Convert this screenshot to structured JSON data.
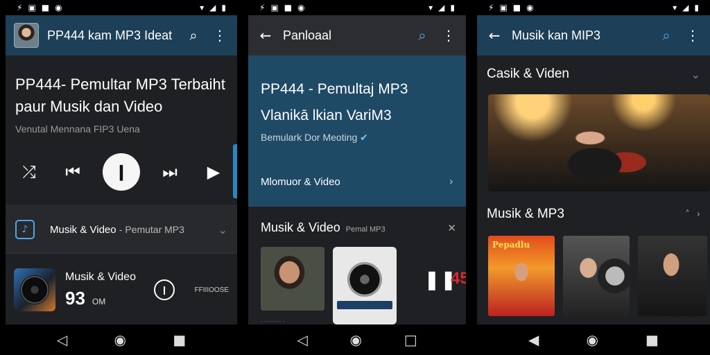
{
  "status_icons": {
    "left": [
      "⚡",
      "▣",
      "■",
      "◉"
    ],
    "right": [
      "▾",
      "◢",
      "▮"
    ]
  },
  "screen1": {
    "appbar_title": "PP444 kam MP3 Ideat",
    "hero_title": "PP444- Pemultar MP3 Terbaiht paur Musik dan Video",
    "hero_subtitle": "Venutal Mennana FIP3 Uena",
    "row_label": "Musik & Video",
    "row_label_sub": "- Pemutar MP3",
    "now_playing_title": "Musik & Video",
    "now_playing_time": "93",
    "now_playing_time_small": "OM",
    "now_playing_right": "FFIIIOOSE"
  },
  "screen2": {
    "appbar_title": "Panloaal",
    "card_title": "PP444 - Pemultaj MP3 Vlanikā lkian VariM3",
    "card_subtitle": "Bemulark Dor Meoting",
    "card_link": "Mlomuor & Video",
    "section_title": "Musik & Video",
    "section_sub": "Pemal MP3",
    "red_text": "45",
    "tiny_text": "· ········ ·"
  },
  "screen3": {
    "appbar_title": "Musik kan MIP3",
    "section1_title": "Casik & Viden",
    "section2_title": "Musik & MP3",
    "album1_label": "Pepadlu"
  },
  "icons": {
    "search": "⌕",
    "more": "⋮",
    "back": "←",
    "chevron_down": "⌄",
    "chevron_right": "›",
    "close": "✕",
    "shuffle": "⤮",
    "prev": "⏮",
    "play_pause": "❙",
    "next": "⏭",
    "play": "▶",
    "pause": "❚❚",
    "nav_back": "◁",
    "nav_home": "◉",
    "nav_recents": "■"
  },
  "colors": {
    "appbar_blue": "#1d3f57",
    "card_blue": "#1f4a66",
    "accent": "#4da8e6",
    "red": "#d52a2a"
  }
}
